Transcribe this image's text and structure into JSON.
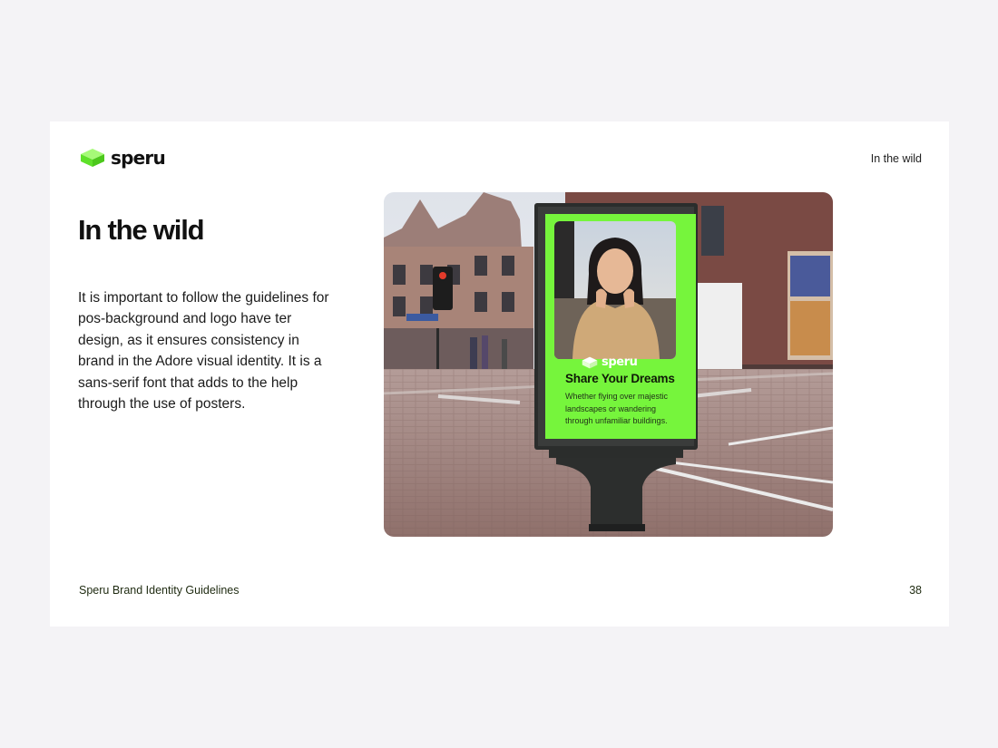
{
  "header": {
    "brand": "speru",
    "section_label": "In the wild"
  },
  "main": {
    "title": "In the wild",
    "body": "It is important to follow the guidelines for pos-background and logo have ter design, as it ensures consistency in brand in the Adore visual identity. It is a sans-serif font that adds to the help through the use of posters."
  },
  "mockup": {
    "brand": "speru",
    "headline": "Share Your Dreams",
    "body": "Whether flying over majestic landscapes or wandering through unfamiliar buildings."
  },
  "footer": {
    "title": "Speru Brand Identity Guidelines",
    "page_number": "38"
  },
  "colors": {
    "accent_green": "#76f53c",
    "page_background": "#f4f3f6",
    "slide_background": "#ffffff",
    "text": "#111111"
  },
  "icons": {
    "logo": "green-cube-logo-icon"
  }
}
